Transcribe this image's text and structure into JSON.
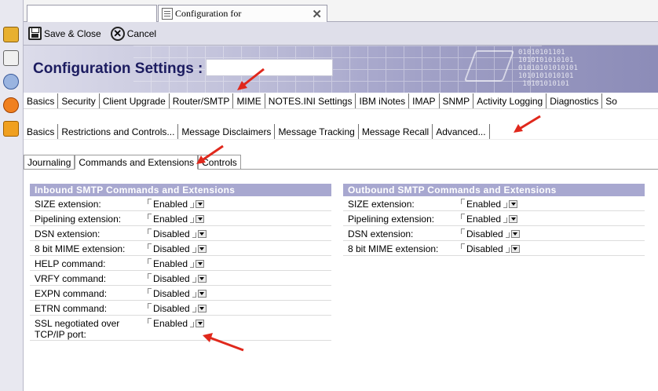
{
  "window": {
    "tab_title": "Configuration for"
  },
  "toolbar": {
    "save_label": "Save & Close",
    "cancel_label": "Cancel"
  },
  "banner": {
    "title": "Configuration Settings :",
    "binary_text": "01010101101\n1010101010101\n01010101010101\n1010101010101\n 10101010101"
  },
  "tabs_level1": [
    "Basics",
    "Security",
    "Client Upgrade",
    "Router/SMTP",
    "MIME",
    "NOTES.INI Settings",
    "IBM iNotes",
    "IMAP",
    "SNMP",
    "Activity Logging",
    "Diagnostics",
    "So"
  ],
  "tabs_level2": [
    "Basics",
    "Restrictions and Controls...",
    "Message Disclaimers",
    "Message Tracking",
    "Message Recall",
    "Advanced..."
  ],
  "tabs_level3": [
    "Journaling",
    "Commands and Extensions",
    "Controls"
  ],
  "inbound": {
    "title": "Inbound SMTP Commands and Extensions",
    "rows": [
      {
        "label": "SIZE extension:",
        "value": "Enabled"
      },
      {
        "label": "Pipelining extension:",
        "value": "Enabled"
      },
      {
        "label": "DSN extension:",
        "value": "Disabled"
      },
      {
        "label": "8 bit MIME extension:",
        "value": "Disabled"
      },
      {
        "label": "HELP command:",
        "value": "Enabled"
      },
      {
        "label": "VRFY command:",
        "value": "Disabled"
      },
      {
        "label": "EXPN command:",
        "value": "Disabled"
      },
      {
        "label": "ETRN command:",
        "value": "Disabled"
      },
      {
        "label": "SSL negotiated over TCP/IP port:",
        "value": "Enabled"
      }
    ]
  },
  "outbound": {
    "title": "Outbound SMTP Commands and Extensions",
    "rows": [
      {
        "label": "SIZE extension:",
        "value": "Enabled"
      },
      {
        "label": "Pipelining extension:",
        "value": "Enabled"
      },
      {
        "label": "DSN extension:",
        "value": "Disabled"
      },
      {
        "label": "8 bit MIME extension:",
        "value": "Disabled"
      }
    ]
  },
  "colors": {
    "panel_header": "#a8a8d0",
    "banner_title": "#1c1c60",
    "annotation_arrow": "#e0281c"
  },
  "icons": {
    "save": "save-icon",
    "cancel": "cancel-icon",
    "dropdown": "dropdown-arrow-icon",
    "annotation": "red-arrow-icon"
  }
}
